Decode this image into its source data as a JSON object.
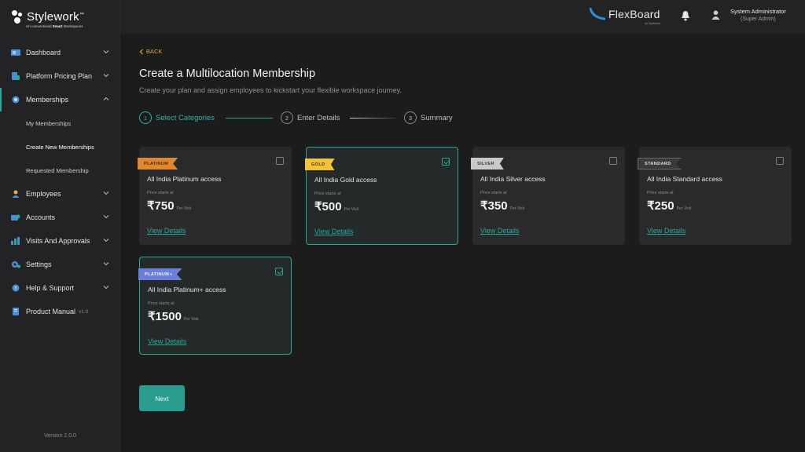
{
  "brand": {
    "name": "Stylework",
    "trademark": "™",
    "tagline_prefix": "Un-conventional ",
    "tagline_bold": "Smart",
    "tagline_suffix": " Workspaces"
  },
  "sidebar": {
    "items": [
      {
        "label": "Dashboard",
        "icon": "dashboard-icon"
      },
      {
        "label": "Platform Pricing Plan",
        "icon": "pricing-icon"
      },
      {
        "label": "Memberships",
        "icon": "membership-icon",
        "expanded": true
      },
      {
        "label": "Employees",
        "icon": "employees-icon"
      },
      {
        "label": "Accounts",
        "icon": "accounts-icon"
      },
      {
        "label": "Visits And Approvals",
        "icon": "visits-icon"
      },
      {
        "label": "Settings",
        "icon": "settings-icon"
      },
      {
        "label": "Help & Support",
        "icon": "help-icon"
      },
      {
        "label": "Product Manual",
        "icon": "manual-icon",
        "version": "v1.0"
      }
    ],
    "sub_items": [
      {
        "label": "My Memberships"
      },
      {
        "label": "Create New Memberships",
        "current": true
      },
      {
        "label": "Requested Membership"
      }
    ],
    "version": "Version 2.0.0"
  },
  "header": {
    "product_name": "FlexBoard",
    "product_by": "by Stylework",
    "user_name": "System Administrator",
    "user_role": "(Super Admin)"
  },
  "main": {
    "back_label": "BACK",
    "title": "Create a Multilocation Membership",
    "subtitle": "Create your plan and assign employees to kickstart your flexible workspace journey.",
    "steps": [
      {
        "num": "1",
        "label": "Select Categories",
        "active": true
      },
      {
        "num": "2",
        "label": "Enter Details",
        "active": false
      },
      {
        "num": "3",
        "label": "Summary",
        "active": false
      }
    ],
    "cards": [
      {
        "badge": "PLATINUM",
        "title": "All India Platinum access",
        "price_label": "Price starts at",
        "price": "₹750",
        "unit": "Per Visit",
        "link": "View Details",
        "selected": false
      },
      {
        "badge": "GOLD",
        "title": "All India Gold access",
        "price_label": "Price starts at",
        "price": "₹500",
        "unit": "Per Visit",
        "link": "View Details",
        "selected": true
      },
      {
        "badge": "SILVER",
        "title": "All India Silver access",
        "price_label": "Price starts at",
        "price": "₹350",
        "unit": "Per Visit",
        "link": "View Details",
        "selected": false
      },
      {
        "badge": "STANDARD",
        "title": "All India Standard access",
        "price_label": "Price starts at",
        "price": "₹250",
        "unit": "Per Visit",
        "link": "View Details",
        "selected": false
      },
      {
        "badge": "PLATINUM",
        "badge_mark": "+",
        "title": "All India Platinum+ access",
        "price_label": "Price starts at",
        "price": "₹1500",
        "unit": "Per Visit",
        "link": "View Details",
        "selected": true
      }
    ],
    "next_label": "Next"
  },
  "colors": {
    "accent": "#2aa89a",
    "back_link": "#e9a23b",
    "platinum_badge": "#e0882f",
    "gold_badge": "#f2c23a",
    "silver_badge": "#c9c9c9",
    "standard_badge": "#3a3a3a",
    "platinum_plus_badge": "#6c7fd8"
  }
}
